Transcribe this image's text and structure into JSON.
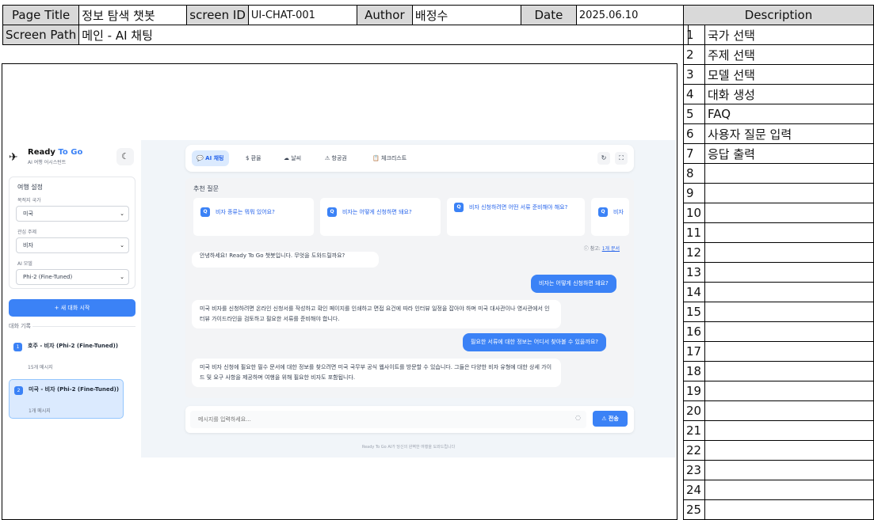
{
  "header": {
    "page_title_label": "Page Title",
    "page_title": "정보 탐색 챗봇",
    "screen_id_label": "screen ID",
    "screen_id": "UI-CHAT-001",
    "author_label": "Author",
    "author": "배정수",
    "date_label": "Date",
    "date": "2025.06.10",
    "screen_path_label": "Screen Path",
    "screen_path": "메인 - AI 채팅"
  },
  "description": {
    "title": "Description",
    "rows": [
      {
        "num": "1",
        "text": "국가 선택"
      },
      {
        "num": "2",
        "text": "주제 선택"
      },
      {
        "num": "3",
        "text": "모델 선택"
      },
      {
        "num": "4",
        "text": "대화 생성"
      },
      {
        "num": "5",
        "text": "FAQ"
      },
      {
        "num": "6",
        "text": "사용자 질문 입력"
      },
      {
        "num": "7",
        "text": "응답 출력"
      },
      {
        "num": "8",
        "text": ""
      },
      {
        "num": "9",
        "text": ""
      },
      {
        "num": "10",
        "text": ""
      },
      {
        "num": "11",
        "text": ""
      },
      {
        "num": "12",
        "text": ""
      },
      {
        "num": "13",
        "text": ""
      },
      {
        "num": "14",
        "text": ""
      },
      {
        "num": "15",
        "text": ""
      },
      {
        "num": "16",
        "text": ""
      },
      {
        "num": "17",
        "text": ""
      },
      {
        "num": "18",
        "text": ""
      },
      {
        "num": "19",
        "text": ""
      },
      {
        "num": "20",
        "text": ""
      },
      {
        "num": "21",
        "text": ""
      },
      {
        "num": "22",
        "text": ""
      },
      {
        "num": "23",
        "text": ""
      },
      {
        "num": "24",
        "text": ""
      },
      {
        "num": "25",
        "text": ""
      }
    ]
  },
  "app": {
    "brand_main": "Ready",
    "brand_accent": "To Go",
    "brand_sub": "AI 여행 어시스턴트",
    "settings": {
      "title": "여행 설정",
      "country_label": "목적지 국가",
      "country_value": "미국",
      "topic_label": "관심 주제",
      "topic_value": "비자",
      "model_label": "AI 모델",
      "model_value": "Phi-2 (Fine-Tuned)"
    },
    "new_chat_label": "+ 새 대화 시작",
    "history_title": "대화 기록",
    "history": [
      {
        "badge": "1",
        "name": "호주 - 비자 (Phi-2 (Fine-Tuned))",
        "count": "15개 메시지"
      },
      {
        "badge": "2",
        "name": "미국 - 비자 (Phi-2 (Fine-Tuned))",
        "count": "1개 메시지"
      }
    ],
    "tabs": [
      {
        "icon": "💬",
        "label": "AI 채팅"
      },
      {
        "icon": "$",
        "label": "환율"
      },
      {
        "icon": "☁",
        "label": "날씨"
      },
      {
        "icon": "⚠",
        "label": "항공권"
      },
      {
        "icon": "📋",
        "label": "체크리스트"
      }
    ],
    "recommend_title": "추천 질문",
    "recommend": [
      {
        "badge": "Q",
        "text": "비자 종류는 뭐뭐 있어요?"
      },
      {
        "badge": "Q",
        "text": "비자는 어떻게 신청하면 돼요?"
      },
      {
        "badge": "Q",
        "text": "비자 신청하려면 어떤 서류 준비해야 해요?"
      },
      {
        "badge": "Q",
        "text": "비자"
      }
    ],
    "reference_prefix": "ⓘ 참고:",
    "reference_link": "1개 문서",
    "messages": [
      {
        "role": "bot",
        "text": "안녕하세요! Ready To Go 챗봇입니다. 무엇을 도와드릴까요?"
      },
      {
        "role": "user",
        "text": "비자는 어떻게 신청하면 돼요?"
      },
      {
        "role": "bot",
        "text": "미국 비자를 신청하려면 온라인 신청서를 작성하고 확인 페이지를 인쇄하고 면접 요건에 따라 인터뷰 일정을 잡아야 하며 미국 대사관이나 영사관에서 인터뷰 가이드라인을 검토하고 필요한 서류를 준비해야 합니다."
      },
      {
        "role": "user",
        "text": "필요한 서류에 대한 정보는 어디서 찾아볼 수 있을까요?"
      },
      {
        "role": "bot",
        "text": "미국 비자 신청에 필요한 필수 문서에 대한 정보를 찾으려면 미국 국무부 공식 웹사이트를 방문할 수 있습니다. 그들은 다양한 비자 유형에 대한 상세 가이드 및 요구 사항을 제공하며 여행을 위해 필요한 비자도 포함됩니다."
      }
    ],
    "input_placeholder": "메시지를 입력하세요...",
    "send_label": "전송",
    "footer": "Ready To Go AI가 당신의 완벽한 여행을 도와드립니다"
  }
}
